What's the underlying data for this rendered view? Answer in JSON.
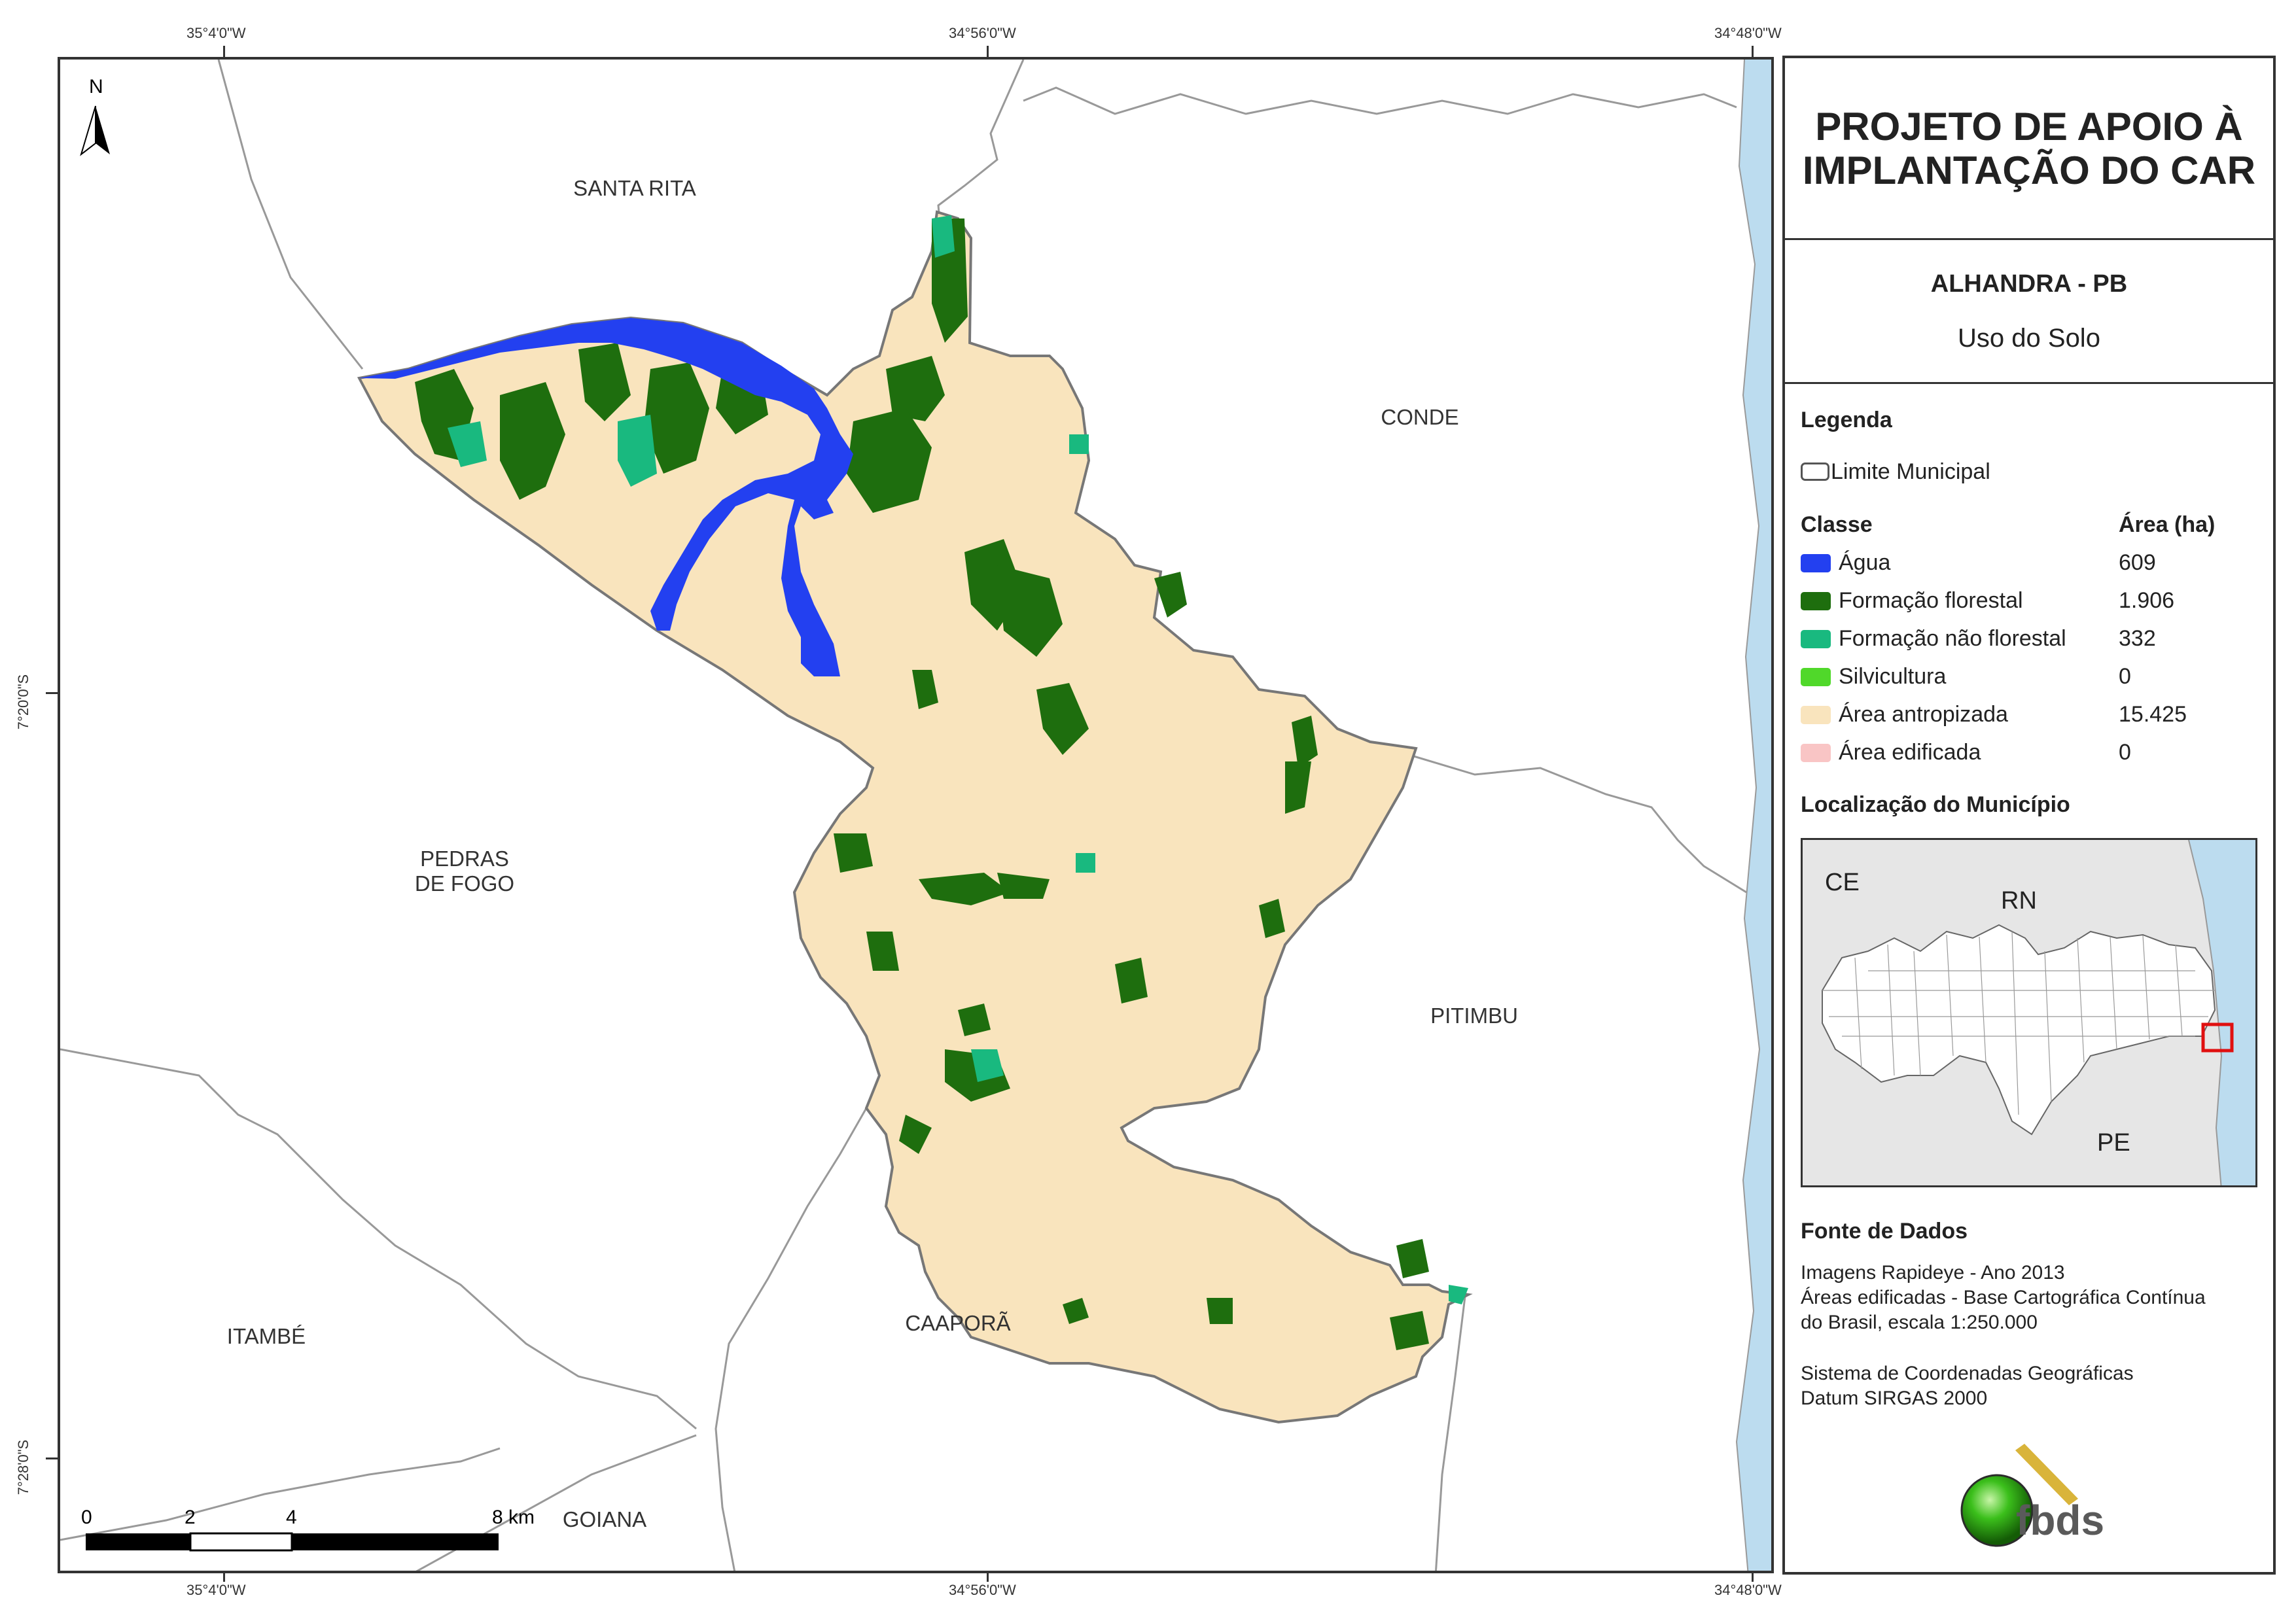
{
  "coords": {
    "top": [
      "35°4'0\"W",
      "34°56'0\"W",
      "34°48'0\"W"
    ],
    "bottom": [
      "35°4'0\"W",
      "34°56'0\"W",
      "34°48'0\"W"
    ],
    "left": [
      "7°20'0\"S",
      "7°28'0\"S"
    ]
  },
  "map": {
    "north_label": "N",
    "municipalities": {
      "santa_rita": "SANTA RITA",
      "conde": "CONDE",
      "pedras_de_fogo": "PEDRAS\nDE FOGO",
      "pitimbu": "PITIMBU",
      "itambe": "ITAMBÉ",
      "caapora": "CAAPORÃ",
      "goiana": "GOIANA"
    },
    "scale_bar": {
      "labels": [
        "0",
        "2",
        "4",
        "8 km"
      ]
    },
    "colors": {
      "agua": "#2340f0",
      "formacao_florestal": "#1e6e0e",
      "formacao_nao_florestal": "#19b97f",
      "silvicultura": "#50d82a",
      "area_antropizada": "#f9e4bd",
      "area_edificada": "#f9c5c5",
      "ocean": "#bcdcef",
      "boundary": "#999999"
    }
  },
  "panel": {
    "title": "PROJETO DE APOIO À IMPLANTAÇÃO DO CAR",
    "title_line1": "PROJETO DE APOIO À",
    "title_line2": "IMPLANTAÇÃO DO CAR",
    "municipality": "ALHANDRA - PB",
    "theme": "Uso do Solo",
    "legend": {
      "heading": "Legenda",
      "boundary_label": "Limite Municipal",
      "class_header": "Classe",
      "area_header": "Área (ha)",
      "classes": [
        {
          "name": "Água",
          "area": "609",
          "color": "#2340f0"
        },
        {
          "name": "Formação florestal",
          "area": "1.906",
          "color": "#1e6e0e"
        },
        {
          "name": "Formação não florestal",
          "area": "332",
          "color": "#19b97f"
        },
        {
          "name": "Silvicultura",
          "area": "0",
          "color": "#50d82a"
        },
        {
          "name": "Área antropizada",
          "area": "15.425",
          "color": "#f9e4bd"
        },
        {
          "name": "Área edificada",
          "area": "0",
          "color": "#f9c5c5"
        }
      ]
    },
    "location": {
      "heading": "Localização do Município",
      "labels": {
        "ce": "CE",
        "rn": "RN",
        "pe": "PE"
      }
    },
    "sources": {
      "heading": "Fonte de Dados",
      "lines": [
        "Imagens Rapideye - Ano 2013",
        "Áreas edificadas - Base Cartográfica Contínua",
        "do Brasil, escala 1:250.000"
      ],
      "crs_lines": [
        "Sistema de Coordenadas Geográficas",
        "Datum SIRGAS 2000"
      ]
    },
    "logo_text": "fbds"
  }
}
